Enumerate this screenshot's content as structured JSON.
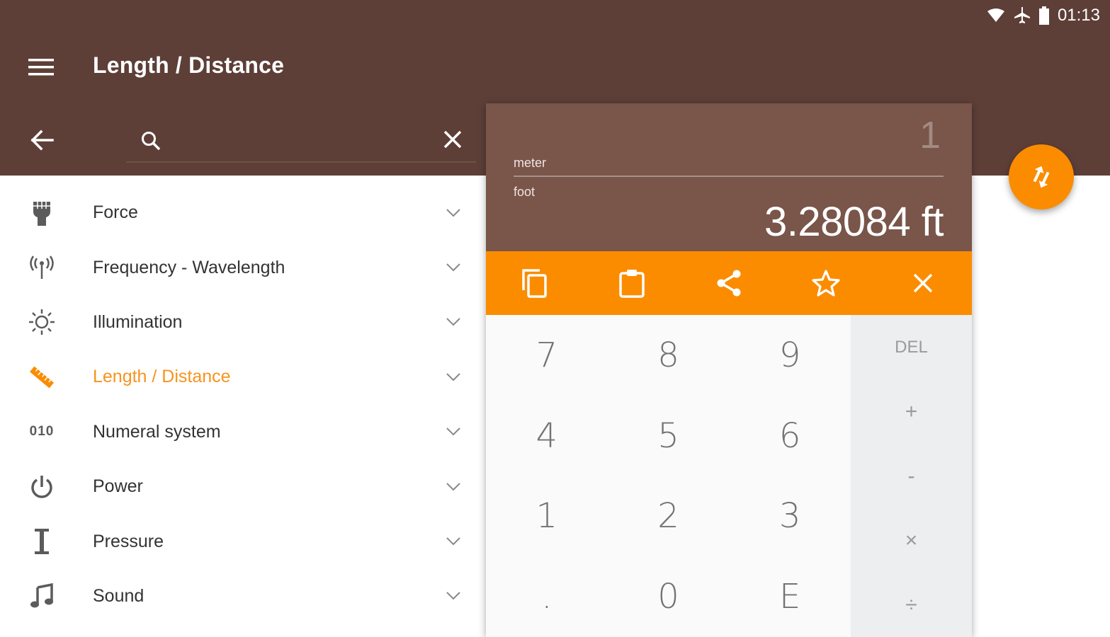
{
  "status_bar": {
    "time": "01:13",
    "icons": [
      "wifi-icon",
      "airplane-icon",
      "battery-icon"
    ]
  },
  "toolbar": {
    "title": "Length / Distance",
    "menu_icon": "menu-icon"
  },
  "search": {
    "placeholder": "",
    "value": ""
  },
  "categories": [
    {
      "label": "Force",
      "icon": "fist-icon"
    },
    {
      "label": "Frequency - Wavelength",
      "icon": "antenna-icon"
    },
    {
      "label": "Illumination",
      "icon": "sun-icon"
    },
    {
      "label": "Length / Distance",
      "icon": "ruler-icon",
      "active": true
    },
    {
      "label": "Numeral system",
      "icon": "numeral-icon",
      "icon_text": "010"
    },
    {
      "label": "Power",
      "icon": "power-icon"
    },
    {
      "label": "Pressure",
      "icon": "pressure-icon"
    },
    {
      "label": "Sound",
      "icon": "music-note-icon"
    }
  ],
  "converter": {
    "input_value": "1",
    "from_unit": "meter",
    "to_unit": "foot",
    "result": "3.28084 ft"
  },
  "actions": [
    "copy-icon",
    "paste-icon",
    "share-icon",
    "favorite-star-icon",
    "close-icon"
  ],
  "keypad": {
    "digits": [
      "7",
      "8",
      "9",
      "4",
      "5",
      "6",
      "1",
      "2",
      "3",
      ".",
      "0",
      "E"
    ],
    "operators": [
      "DEL",
      "+",
      "-",
      "×",
      "÷"
    ]
  },
  "colors": {
    "appbar": "#5d3f38",
    "converter_panel": "#79554a",
    "accent": "#fb8c00",
    "active_text": "#f7941d"
  }
}
